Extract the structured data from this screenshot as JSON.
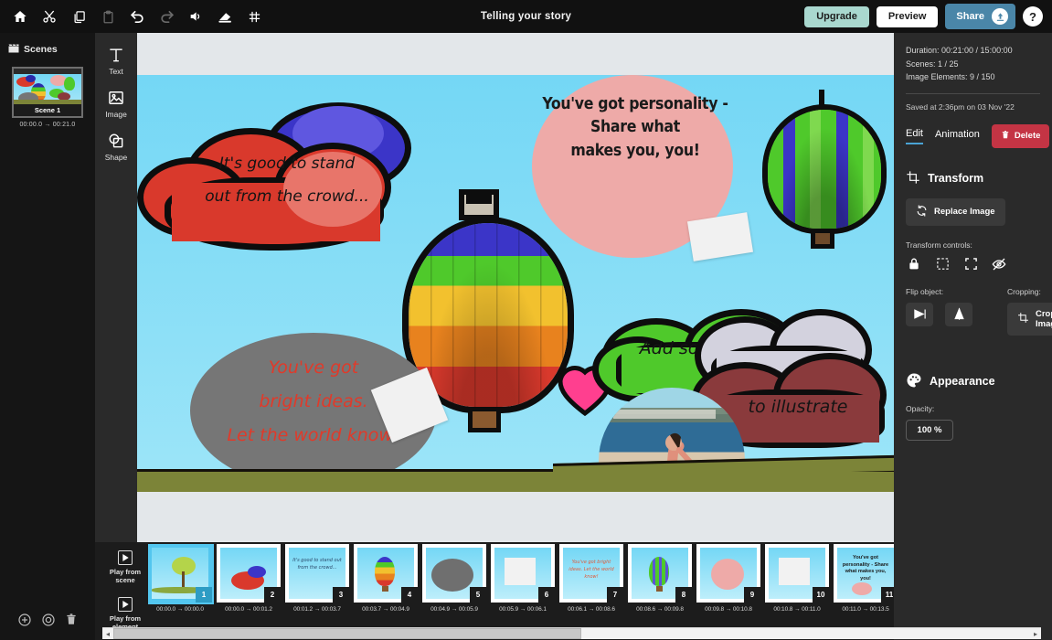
{
  "app": {
    "title": "Telling your story"
  },
  "toolbar": {
    "icons": [
      {
        "name": "home-icon",
        "label": "Home"
      },
      {
        "name": "cut-icon",
        "label": "Cut"
      },
      {
        "name": "copy-icon",
        "label": "Copy"
      },
      {
        "name": "paste-icon",
        "label": "Paste"
      },
      {
        "name": "undo-icon",
        "label": "Undo"
      },
      {
        "name": "redo-icon",
        "label": "Redo"
      },
      {
        "name": "audio-icon",
        "label": "Audio"
      },
      {
        "name": "eraser-icon",
        "label": "Eraser"
      },
      {
        "name": "grid-icon",
        "label": "Grid"
      }
    ],
    "upgrade_label": "Upgrade",
    "preview_label": "Preview",
    "share_label": "Share",
    "help_label": "?"
  },
  "scenes": {
    "header": "Scenes",
    "items": [
      {
        "label": "Scene 1",
        "start": "00:00.0",
        "end": "00:21.0",
        "arrow": "→"
      }
    ]
  },
  "tools": [
    {
      "name": "text-tool",
      "label": "Text"
    },
    {
      "name": "image-tool",
      "label": "Image"
    },
    {
      "name": "shape-tool",
      "label": "Shape"
    }
  ],
  "canvas": {
    "texts": {
      "red_cloud": "It's good to stand\nout from the crowd...",
      "pink_circle": "You've got personality -\nShare what\nmakes you, you!",
      "gray_ellipse": "You've got\nbright ideas.\nLet the world know!",
      "green_cloud": "Add some pics",
      "maroon_cloud": "to illustrate"
    },
    "colors": {
      "sky": "#74d7f5",
      "grass": "#7c8438",
      "red_cloud": "#d9392c",
      "pink_circle": "#eeaaa8",
      "gray_ellipse": "#767676",
      "green_cloud": "#4fc92b",
      "maroon_cloud": "#8a3a3c",
      "heart": "#ff3f8f",
      "script_text_red": "#e03a2a"
    }
  },
  "inspector": {
    "duration_label": "Duration: 00:21:00 / 15:00:00",
    "scenes_label": "Scenes: 1 / 25",
    "image_elements_label": "Image Elements: 9 / 150",
    "saved_label": "Saved at 2:36pm on 03 Nov '22",
    "tabs": [
      {
        "name": "tab-edit",
        "label": "Edit",
        "active": true
      },
      {
        "name": "tab-animation",
        "label": "Animation",
        "active": false
      }
    ],
    "delete_label": "Delete",
    "transform": {
      "title": "Transform",
      "replace_image_label": "Replace Image",
      "controls_label": "Transform controls:",
      "controls": [
        {
          "name": "lock-icon",
          "label": "Lock"
        },
        {
          "name": "select-area-icon",
          "label": "Select area"
        },
        {
          "name": "fullscreen-icon",
          "label": "Fit"
        },
        {
          "name": "hide-icon",
          "label": "Hide"
        }
      ],
      "flip_label": "Flip object:",
      "flip_buttons": [
        {
          "name": "flip-horizontal-icon",
          "label": "Flip horizontal"
        },
        {
          "name": "flip-vertical-icon",
          "label": "Flip vertical"
        }
      ],
      "cropping_label": "Cropping:",
      "crop_image_label": "Crop Image"
    },
    "appearance": {
      "title": "Appearance",
      "opacity_label": "Opacity:",
      "opacity_value": "100  %"
    },
    "accent": "#4aa3d4",
    "delete_color": "#c43444"
  },
  "timeline": {
    "play_from_scene_label": "Play from\nscene",
    "play_from_element_label": "Play from\nelement",
    "arrow": "→",
    "elements": [
      {
        "num": "1",
        "start": "00:00.0",
        "end": "00:00.0",
        "kind": "tree",
        "selected": true
      },
      {
        "num": "2",
        "start": "00:00.0",
        "end": "00:01.2",
        "kind": "red-cloud",
        "selected": false
      },
      {
        "num": "3",
        "start": "00:01.2",
        "end": "00:03.7",
        "kind": "text-crowd",
        "text": "It's good to stand out from the crowd...",
        "selected": false
      },
      {
        "num": "4",
        "start": "00:03.7",
        "end": "00:04.9",
        "kind": "balloon-rainbow",
        "selected": false
      },
      {
        "num": "5",
        "start": "00:04.9",
        "end": "00:05.9",
        "kind": "gray-ellipse",
        "selected": false
      },
      {
        "num": "6",
        "start": "00:05.9",
        "end": "00:06.1",
        "kind": "white-square",
        "selected": false
      },
      {
        "num": "7",
        "start": "00:06.1",
        "end": "00:08.6",
        "kind": "text-ideas",
        "text": "You've got bright ideas. Let the world know!",
        "selected": false
      },
      {
        "num": "8",
        "start": "00:08.6",
        "end": "00:09.8",
        "kind": "balloon-green",
        "selected": false
      },
      {
        "num": "9",
        "start": "00:09.8",
        "end": "00:10.8",
        "kind": "pink-circle",
        "selected": false
      },
      {
        "num": "10",
        "start": "00:10.8",
        "end": "00:11.0",
        "kind": "white-square",
        "selected": false
      },
      {
        "num": "11",
        "start": "00:11.0",
        "end": "00:13.5",
        "kind": "text-personality",
        "text": "You've got personality - Share what makes you, you!",
        "selected": false
      }
    ]
  }
}
